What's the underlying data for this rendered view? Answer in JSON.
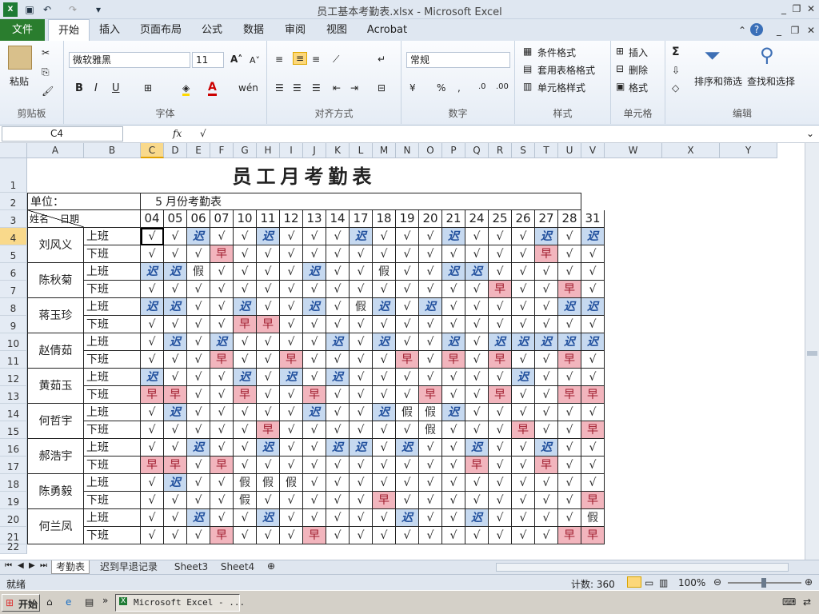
{
  "window": {
    "title": "员工基本考勤表.xlsx  -  Microsoft Excel"
  },
  "ribbon_tabs": [
    "文件",
    "开始",
    "插入",
    "页面布局",
    "公式",
    "数据",
    "审阅",
    "视图",
    "Acrobat"
  ],
  "ribbon": {
    "paste": "粘贴",
    "font_name": "微软雅黑",
    "font_size": "11",
    "number_format": "常规",
    "cond_format": "条件格式",
    "table_format": "套用表格格式",
    "cell_styles": "单元格样式",
    "insert": "插入",
    "delete": "删除",
    "format": "格式",
    "sort_filter": "排序和筛选",
    "find_select": "查找和选择",
    "groups": [
      "剪贴板",
      "字体",
      "对齐方式",
      "数字",
      "样式",
      "单元格",
      "编辑"
    ]
  },
  "formula_bar": {
    "name_box": "C4",
    "fx": "fx",
    "value": "√"
  },
  "columns": [
    "A",
    "B",
    "C",
    "D",
    "E",
    "F",
    "G",
    "H",
    "I",
    "J",
    "K",
    "L",
    "M",
    "N",
    "O",
    "P",
    "Q",
    "R",
    "S",
    "T",
    "U",
    "V",
    "W",
    "X",
    "Y"
  ],
  "rows": [
    "1",
    "2",
    "3",
    "4",
    "5",
    "6",
    "7",
    "8",
    "9",
    "10",
    "11",
    "12",
    "13",
    "14",
    "15",
    "16",
    "17",
    "18",
    "19",
    "20",
    "21",
    "22"
  ],
  "sheet": {
    "title": "员工月考勤表",
    "unit_label": "单位：",
    "month": "5",
    "month_label": "月份考勤表",
    "header_date": "日期",
    "header_name": "姓名",
    "dates": [
      "04",
      "05",
      "06",
      "07",
      "10",
      "11",
      "12",
      "13",
      "14",
      "17",
      "18",
      "19",
      "20",
      "21",
      "24",
      "25",
      "26",
      "27",
      "28",
      "31"
    ],
    "shift_on": "上班",
    "shift_off": "下班",
    "employees": [
      {
        "name": "刘风义",
        "on": [
          "√",
          "√",
          "迟",
          "√",
          "√",
          "迟",
          "√",
          "√",
          "√",
          "迟",
          "√",
          "√",
          "√",
          "迟",
          "√",
          "√",
          "√",
          "迟",
          "√",
          "迟"
        ],
        "off": [
          "√",
          "√",
          "√",
          "早",
          "√",
          "√",
          "√",
          "√",
          "√",
          "√",
          "√",
          "√",
          "√",
          "√",
          "√",
          "√",
          "√",
          "早",
          "√",
          "√"
        ]
      },
      {
        "name": "陈秋菊",
        "on": [
          "迟",
          "迟",
          "假",
          "√",
          "√",
          "√",
          "√",
          "迟",
          "√",
          "√",
          "假",
          "√",
          "√",
          "迟",
          "迟",
          "√",
          "√",
          "√",
          "√",
          "√"
        ],
        "off": [
          "√",
          "√",
          "√",
          "√",
          "√",
          "√",
          "√",
          "√",
          "√",
          "√",
          "√",
          "√",
          "√",
          "√",
          "√",
          "早",
          "√",
          "√",
          "早",
          "√"
        ]
      },
      {
        "name": "蒋玉珍",
        "on": [
          "迟",
          "迟",
          "√",
          "√",
          "迟",
          "√",
          "√",
          "迟",
          "√",
          "假",
          "迟",
          "√",
          "迟",
          "√",
          "√",
          "√",
          "√",
          "√",
          "迟",
          "迟"
        ],
        "off": [
          "√",
          "√",
          "√",
          "√",
          "早",
          "早",
          "√",
          "√",
          "√",
          "√",
          "√",
          "√",
          "√",
          "√",
          "√",
          "√",
          "√",
          "√",
          "√",
          "√"
        ]
      },
      {
        "name": "赵倩茹",
        "on": [
          "√",
          "迟",
          "√",
          "迟",
          "√",
          "√",
          "√",
          "√",
          "迟",
          "√",
          "迟",
          "√",
          "√",
          "迟",
          "√",
          "迟",
          "迟",
          "迟",
          "迟",
          "迟"
        ],
        "off": [
          "√",
          "√",
          "√",
          "早",
          "√",
          "√",
          "早",
          "√",
          "√",
          "√",
          "√",
          "早",
          "√",
          "早",
          "√",
          "早",
          "√",
          "√",
          "早",
          "√"
        ]
      },
      {
        "name": "黄茹玉",
        "on": [
          "迟",
          "√",
          "√",
          "√",
          "迟",
          "√",
          "迟",
          "√",
          "迟",
          "√",
          "√",
          "√",
          "√",
          "√",
          "√",
          "√",
          "迟",
          "√",
          "√",
          "√"
        ],
        "off": [
          "早",
          "早",
          "√",
          "√",
          "早",
          "√",
          "√",
          "早",
          "√",
          "√",
          "√",
          "√",
          "早",
          "√",
          "√",
          "早",
          "√",
          "√",
          "早",
          "早"
        ]
      },
      {
        "name": "何哲宇",
        "on": [
          "√",
          "迟",
          "√",
          "√",
          "√",
          "√",
          "√",
          "迟",
          "√",
          "√",
          "迟",
          "假",
          "假",
          "迟",
          "√",
          "√",
          "√",
          "√",
          "√",
          "√"
        ],
        "off": [
          "√",
          "√",
          "√",
          "√",
          "√",
          "早",
          "√",
          "√",
          "√",
          "√",
          "√",
          "√",
          "假",
          "√",
          "√",
          "√",
          "早",
          "√",
          "√",
          "早"
        ]
      },
      {
        "name": "郝浩宇",
        "on": [
          "√",
          "√",
          "迟",
          "√",
          "√",
          "迟",
          "√",
          "√",
          "迟",
          "迟",
          "√",
          "迟",
          "√",
          "√",
          "迟",
          "√",
          "√",
          "迟",
          "√",
          "√"
        ],
        "off": [
          "早",
          "早",
          "√",
          "早",
          "√",
          "√",
          "√",
          "√",
          "√",
          "√",
          "√",
          "√",
          "√",
          "√",
          "早",
          "√",
          "√",
          "早",
          "√",
          "√"
        ]
      },
      {
        "name": "陈勇毅",
        "on": [
          "√",
          "迟",
          "√",
          "√",
          "假",
          "假",
          "假",
          "√",
          "√",
          "√",
          "√",
          "√",
          "√",
          "√",
          "√",
          "√",
          "√",
          "√",
          "√",
          "√"
        ],
        "off": [
          "√",
          "√",
          "√",
          "√",
          "假",
          "√",
          "√",
          "√",
          "√",
          "√",
          "早",
          "√",
          "√",
          "√",
          "√",
          "√",
          "√",
          "√",
          "√",
          "早"
        ]
      },
      {
        "name": "何兰凤",
        "on": [
          "√",
          "√",
          "迟",
          "√",
          "√",
          "迟",
          "√",
          "√",
          "√",
          "√",
          "√",
          "迟",
          "√",
          "√",
          "迟",
          "√",
          "√",
          "√",
          "√",
          "假"
        ],
        "off": [
          "√",
          "√",
          "√",
          "早",
          "√",
          "√",
          "√",
          "早",
          "√",
          "√",
          "√",
          "√",
          "√",
          "√",
          "√",
          "√",
          "√",
          "√",
          "早",
          "早"
        ]
      }
    ]
  },
  "sheet_tabs": [
    "考勤表",
    "迟到早退记录",
    "Sheet3",
    "Sheet4"
  ],
  "status": {
    "ready": "就绪",
    "count": "计数: 360",
    "zoom": "100%"
  },
  "taskbar": {
    "start": "开始",
    "app": "Microsoft Excel - ..."
  }
}
